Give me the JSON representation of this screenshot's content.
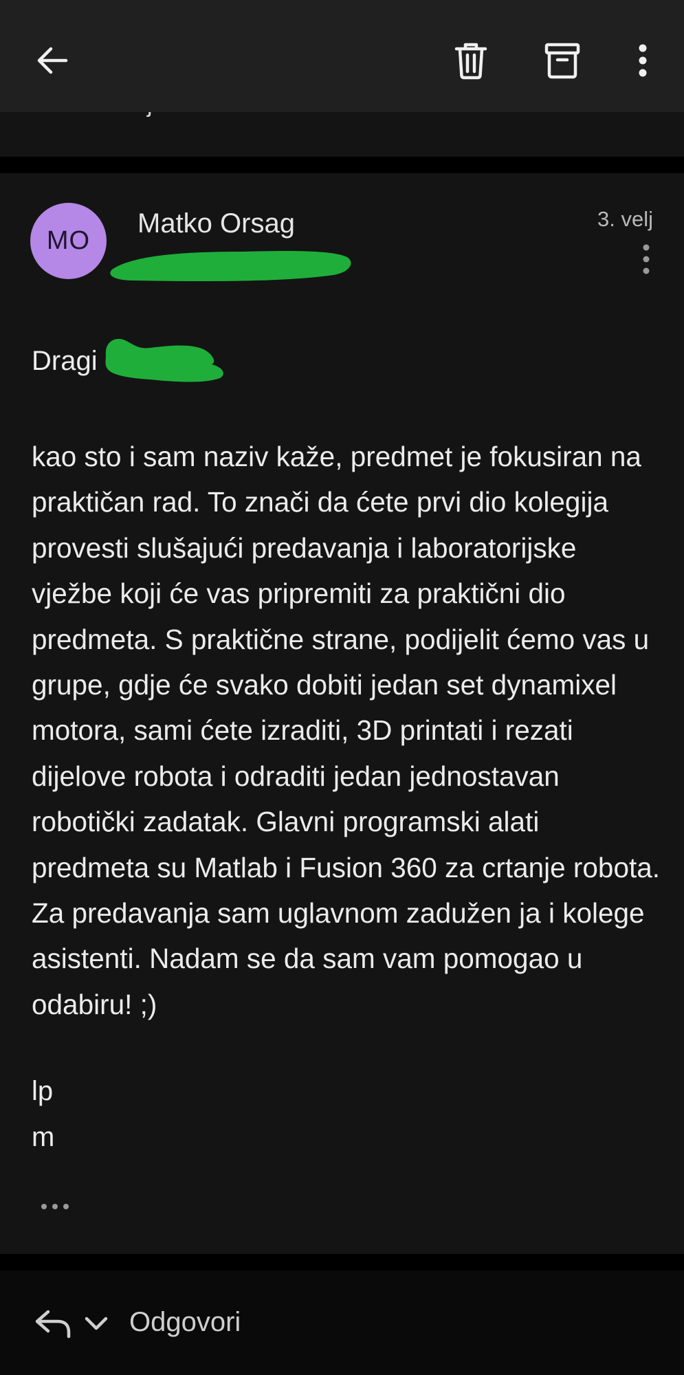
{
  "colors": {
    "background": "#000000",
    "topbar": "#202020",
    "card": "#141414",
    "avatar": "#b587e6",
    "redaction": "#1fae3a",
    "text": "#ececec",
    "muted": "#b9b9b9"
  },
  "toolbar": {
    "back_icon": "arrow-left-icon",
    "delete_icon": "trash-icon",
    "archive_icon": "archive-icon",
    "more_icon": "more-vertical-icon"
  },
  "previous_message": {
    "snippet": "j"
  },
  "message": {
    "avatar_initials": "MO",
    "sender_name": "Matko Orsag",
    "date": "3. velj",
    "greeting": "Dragi",
    "body": "kao sto i sam naziv kaže, predmet je fokusiran na praktičan rad. To znači da ćete prvi dio kolegija provesti slušajući predavanja i laboratorijske vježbe koji će vas pripremiti za praktični dio predmeta. S praktične strane, podijelit ćemo vas u grupe, gdje će svako dobiti jedan set dynamixel motora, sami ćete izraditi, 3D printati i rezati dijelove robota i odraditi jedan jednostavan robotički zadatak. Glavni programski alati predmeta su Matlab i Fusion 360 za crtanje robota. Za predavanja sam uglavnom zadužen ja i kolege asistenti. Nadam se da sam vam pomogao u odabiru! ;)",
    "signature_line1": "lp",
    "signature_line2": "m"
  },
  "bottom_bar": {
    "reply_label": "Odgovori",
    "reply_icon": "reply-icon",
    "chevron_icon": "chevron-down-icon"
  }
}
